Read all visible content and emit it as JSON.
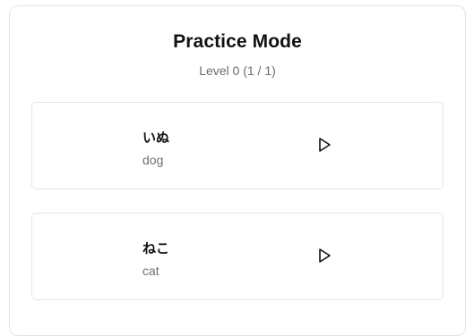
{
  "header": {
    "title": "Practice Mode",
    "progress": "Level 0 (1 / 1)"
  },
  "cards": [
    {
      "word": "いぬ",
      "meaning": "dog",
      "action_icon": "play-icon"
    },
    {
      "word": "ねこ",
      "meaning": "cat",
      "action_icon": "play-icon"
    }
  ],
  "colors": {
    "border": "#e3e3e3",
    "title": "#111111",
    "muted": "#6b6b6b"
  }
}
